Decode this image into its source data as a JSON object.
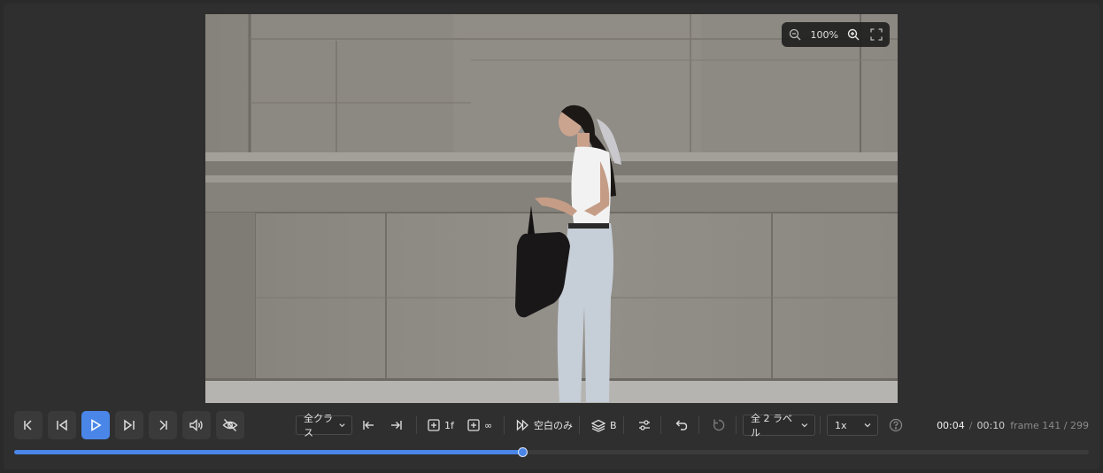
{
  "viewer": {
    "zoom_level": "100%",
    "icons": {
      "zoom_out": "zoom-out-icon",
      "zoom_in": "zoom-in-icon",
      "fullscreen": "fullscreen-icon"
    }
  },
  "toolbar": {
    "class_filter": "全クラス",
    "label_filter": "全 2 ラベル",
    "speed": "1x",
    "step_one": "1f",
    "step_infinite": "∞",
    "blank_only": "空白のみ",
    "layer_label": "B",
    "icons": [
      "skip-to-start-icon",
      "previous-frame-icon",
      "play-icon",
      "next-frame-icon",
      "skip-to-end-icon",
      "volume-icon",
      "hide-icon",
      "jump-start-icon",
      "jump-end-icon",
      "add-frame-icon",
      "add-infinite-icon",
      "fast-forward-icon",
      "layers-icon",
      "settings-sliders-icon",
      "undo-icon",
      "redo-icon",
      "help-icon"
    ]
  },
  "time": {
    "current": "00:04",
    "separator": "/",
    "total": "00:10",
    "frame": "frame 141 / 299"
  },
  "playback": {
    "progress": 0.473
  },
  "colors": {
    "accent": "#4a86e8",
    "background": "#2f2f2f"
  }
}
